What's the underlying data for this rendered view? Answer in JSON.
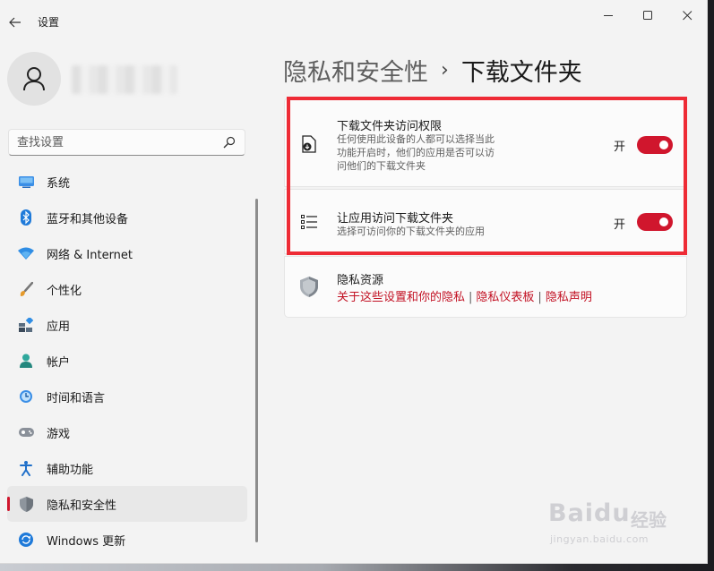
{
  "window": {
    "app_title": "设置",
    "back_icon": "arrow-left-icon",
    "controls": [
      "minimize-icon",
      "maximize-icon",
      "close-icon"
    ]
  },
  "profile": {
    "avatar_icon": "user-icon"
  },
  "search": {
    "placeholder": "查找设置",
    "icon": "search-icon"
  },
  "nav": {
    "items": [
      {
        "label": "系统",
        "icon": "system-icon",
        "active": false
      },
      {
        "label": "蓝牙和其他设备",
        "icon": "bluetooth-icon",
        "active": false
      },
      {
        "label": "网络 & Internet",
        "icon": "wifi-icon",
        "active": false
      },
      {
        "label": "个性化",
        "icon": "brush-icon",
        "active": false
      },
      {
        "label": "应用",
        "icon": "apps-icon",
        "active": false
      },
      {
        "label": "帐户",
        "icon": "account-icon",
        "active": false
      },
      {
        "label": "时间和语言",
        "icon": "time-language-icon",
        "active": false
      },
      {
        "label": "游戏",
        "icon": "gamepad-icon",
        "active": false
      },
      {
        "label": "辅助功能",
        "icon": "accessibility-icon",
        "active": false
      },
      {
        "label": "隐私和安全性",
        "icon": "shield-icon",
        "active": true
      },
      {
        "label": "Windows 更新",
        "icon": "update-icon",
        "active": false
      }
    ]
  },
  "main": {
    "breadcrumb": {
      "parent": "隐私和安全性",
      "separator": "›",
      "current": "下载文件夹"
    },
    "settings": [
      {
        "title": "下载文件夹访问权限",
        "description": [
          "任何使用此设备的人都可以选择当此",
          "功能开启时，他们的应用是否可以访",
          "问他们的下载文件夹"
        ],
        "state_label": "开",
        "on": true,
        "icon": "download-folder-icon"
      },
      {
        "title": "让应用访问下载文件夹",
        "description": [
          "选择可访问你的下载文件夹的应用"
        ],
        "state_label": "开",
        "on": true,
        "icon": "list-icon"
      }
    ],
    "privacy_resources": {
      "title": "隐私资源",
      "icon": "shield-icon",
      "links": [
        "关于这些设置和你的隐私",
        "隐私仪表板",
        "隐私声明"
      ],
      "link_separator": "|"
    }
  },
  "watermark": {
    "brand": "Baidu",
    "cn": "经验",
    "url": "jingyan.baidu.com"
  },
  "colors": {
    "accent": "#d0162d",
    "link": "#c21123",
    "highlight": "#ee2b35",
    "background": "#f3f3f3",
    "card": "#fbfbfb"
  }
}
